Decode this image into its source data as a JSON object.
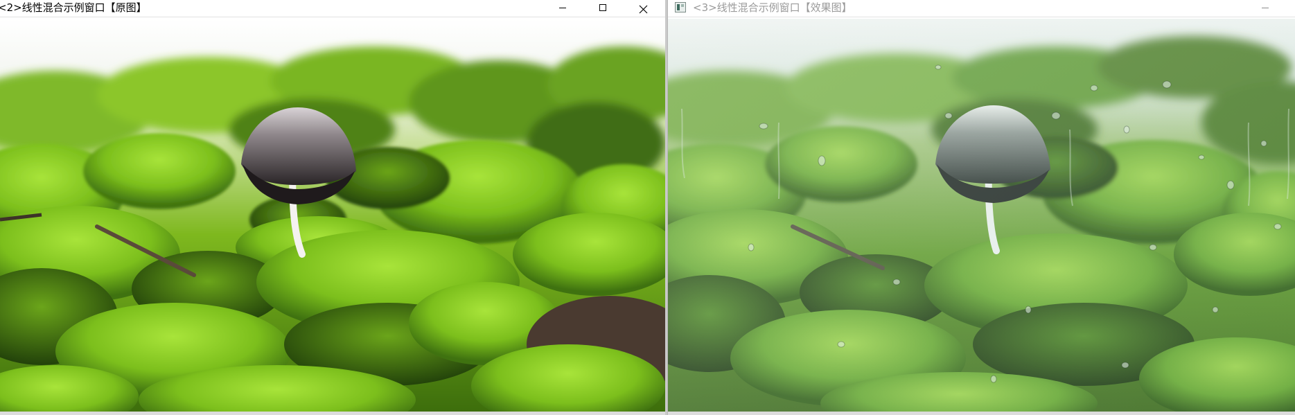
{
  "window_left": {
    "title": "<2>线性混合示例窗口【原图】",
    "image_label": "mushroom-on-moss-original",
    "controls": {
      "minimize": "minimize-icon",
      "maximize": "maximize-icon",
      "close": "close-icon"
    }
  },
  "window_right": {
    "title": "<3>线性混合示例窗口【效果图】",
    "image_label": "mushroom-on-moss-blended-with-raindrop-glass",
    "controls": {
      "minimize": "minimize-icon"
    }
  },
  "colors": {
    "moss_bright": "#8fd02a",
    "moss_dark": "#2f5a0c",
    "sky": "#ffffff",
    "mushroom_cap": "#4a4446",
    "blend_tint": "#cfe6dc"
  }
}
